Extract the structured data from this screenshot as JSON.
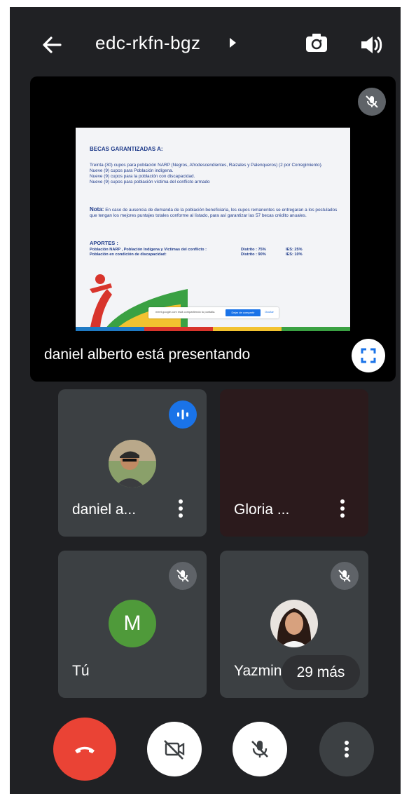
{
  "header": {
    "meeting_code": "edc-rkfn-bgz"
  },
  "presentation": {
    "caption": "daniel alberto está presentando",
    "slide": {
      "title": "BECAS GARANTIZADAS A:",
      "body_lines": [
        "Treinta (30) cupos para población NARP (Negros, Afrodescendientes, Raizales y Palenqueros) (2 por Corregimiento).",
        "Nueve (9) cupos para Población indígena.",
        "Nueve (9) cupos para la población con discapacidad.",
        "Nueve (9) cupos para población víctima del conflicto armado"
      ],
      "nota_label": "Nota:",
      "nota_text": "En caso de ausencia de demanda de la población beneficiaria, los cupos remanentes se entregaran a los postulados que tengan los mejores puntajes totales conforme al listado, para así garantizar las 57 becas crédito anuales.",
      "aportes_title": "APORTES :",
      "aportes_rows": [
        {
          "label": "Población NARP , Población Indígena y Victimas del conflicto :",
          "distrito": "Distrito : 75%",
          "ies": "IES: 25%"
        },
        {
          "label": "Población en condición de discapacidad:",
          "distrito": "Distrito : 90%",
          "ies": "IES: 10%"
        }
      ],
      "share_bar": {
        "text": "meet.google.com está compartiendo tu pantalla.",
        "stop_label": "Dejar de compartir",
        "hide_label": "Ocultar"
      }
    }
  },
  "participants": [
    {
      "name": "daniel a...",
      "speaking": true
    },
    {
      "name": "Gloria ...",
      "muted": false
    },
    {
      "name": "Tú",
      "initial": "M",
      "muted": true
    },
    {
      "name": "Yazmin",
      "muted": true
    }
  ],
  "more_participants": "29 más",
  "colors": {
    "background": "#202124",
    "tile": "#3c4043",
    "gloria_tile": "#2b1a1c",
    "end_call": "#ea4335",
    "speaking_badge": "#1a73e8",
    "avatar_m": "#4f9a3a"
  }
}
